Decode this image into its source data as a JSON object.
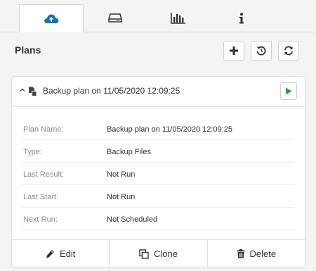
{
  "tabs": [
    {
      "icon": "cloud-upload-icon",
      "active": true
    },
    {
      "icon": "hard-drive-icon",
      "active": false
    },
    {
      "icon": "bar-chart-icon",
      "active": false
    },
    {
      "icon": "info-icon",
      "active": false
    }
  ],
  "header": {
    "title": "Plans",
    "actions": [
      {
        "icon": "plus-icon"
      },
      {
        "icon": "history-icon"
      },
      {
        "icon": "refresh-icon"
      }
    ]
  },
  "plan": {
    "title": "Backup plan on 11/05/2020 12:09:25",
    "expanded": true,
    "details": [
      {
        "label": "Plan Name:",
        "value": "Backup plan on 11/05/2020 12:09:25"
      },
      {
        "label": "Type:",
        "value": "Backup Files"
      },
      {
        "label": "Last Result:",
        "value": "Not Run"
      },
      {
        "label": "Last Start:",
        "value": "Not Run"
      },
      {
        "label": "Next Run:",
        "value": "Not Scheduled"
      }
    ],
    "footer": {
      "edit_label": "Edit",
      "clone_label": "Clone",
      "delete_label": "Delete"
    }
  },
  "colors": {
    "accent_blue": "#1a6fb8",
    "run_green": "#2e9e3c"
  }
}
